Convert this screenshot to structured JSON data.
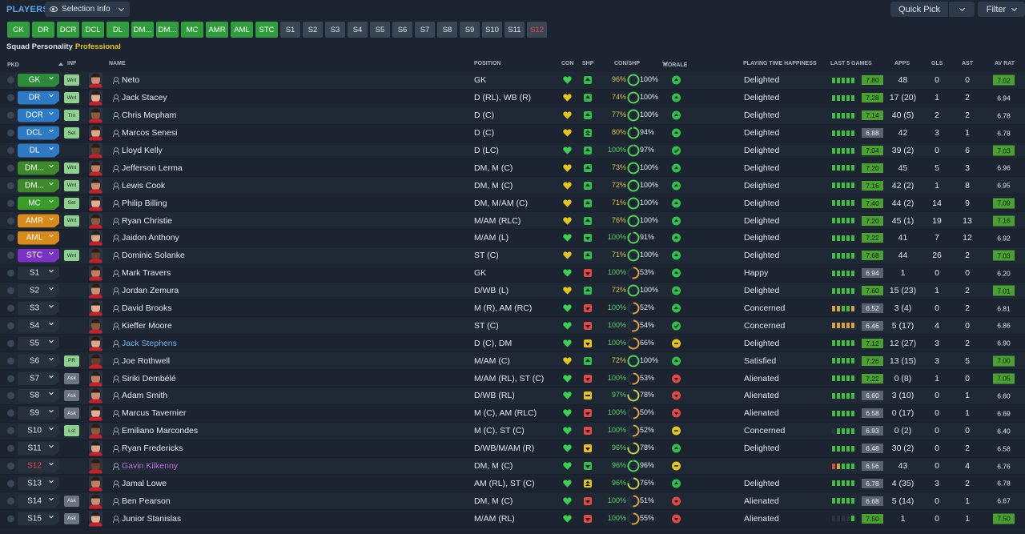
{
  "header": {
    "section_title": "PLAYERS",
    "selection_info_label": "Selection Info",
    "quick_pick_label": "Quick Pick",
    "filter_label": "Filter"
  },
  "position_buttons": {
    "main": [
      "GK",
      "DR",
      "DCR",
      "DCL",
      "DL",
      "DM...",
      "DM...",
      "MC",
      "AMR",
      "AML",
      "STC"
    ],
    "subs": [
      "S1",
      "S2",
      "S3",
      "S4",
      "S5",
      "S6",
      "S7",
      "S8",
      "S9",
      "S10",
      "S11",
      "S12"
    ]
  },
  "squad_personality": {
    "label": "Squad Personality",
    "value": "Professional"
  },
  "columns": {
    "pkd": "PKD",
    "inf": "INF",
    "name": "NAME",
    "position": "POSITION",
    "con": "CON",
    "shp": "SHP",
    "conshp": "CON/SHP",
    "morale": "MORALE",
    "pth": "PLAYING TIME HAPPINESS",
    "last5": "LAST 5 GAMES",
    "apps": "APPS",
    "gls": "GLS",
    "ast": "AST",
    "avrat": "AV RAT"
  },
  "colors": {
    "rating_hi": "#4aa030",
    "con_yellow": "#d8c24a",
    "con_green": "#57d16a",
    "personality": "#e6c419"
  },
  "players": [
    {
      "sel": "GK",
      "selc": "gk",
      "inf": "Wnt",
      "infc": "green",
      "name": "Neto",
      "pos": "GK",
      "con": "green",
      "shp": "green",
      "shp_icon": "up",
      "con_pct": "96%",
      "con_hi": false,
      "shp_pct": "100%",
      "ring": 1.0,
      "morale": "a",
      "pth": "Delighted",
      "l5": [
        "g",
        "g",
        "g",
        "g",
        "g"
      ],
      "l5r": "7.80",
      "l5c": "g",
      "apps": "48",
      "gls": "0",
      "ast": "0",
      "av": "7.02",
      "avhi": true
    },
    {
      "sel": "DR",
      "selc": "d",
      "inf": "Wnt",
      "infc": "green",
      "name": "Jack Stacey",
      "pos": "D (RL), WB (R)",
      "con": "yellow",
      "shp": "green",
      "shp_icon": "up",
      "con_pct": "74%",
      "con_hi": false,
      "shp_pct": "100%",
      "ring": 1.0,
      "morale": "a",
      "pth": "Delighted",
      "l5": [
        "g",
        "g",
        "g",
        "g",
        "g"
      ],
      "l5r": "7.28",
      "l5c": "g",
      "apps": "17 (20)",
      "gls": "1",
      "ast": "2",
      "av": "6.94",
      "avhi": false
    },
    {
      "sel": "DCR",
      "selc": "d",
      "inf": "Trn",
      "infc": "green",
      "name": "Chris Mepham",
      "pos": "D (C)",
      "con": "yellow",
      "shp": "green",
      "shp_icon": "up",
      "con_pct": "77%",
      "con_hi": false,
      "shp_pct": "100%",
      "ring": 1.0,
      "morale": "a",
      "pth": "Delighted",
      "l5": [
        "g",
        "g",
        "g",
        "g",
        "g"
      ],
      "l5r": "7.14",
      "l5c": "g",
      "apps": "40 (5)",
      "gls": "2",
      "ast": "2",
      "av": "6.78",
      "avhi": false
    },
    {
      "sel": "DCL",
      "selc": "d",
      "inf": "Set",
      "infc": "green",
      "name": "Marcos Senesi",
      "pos": "D (C)",
      "con": "yellow",
      "shp": "green",
      "shp_icon": "upup",
      "con_pct": "80%",
      "con_hi": false,
      "shp_pct": "94%",
      "ring": 0.94,
      "morale": "a",
      "pth": "Delighted",
      "l5": [
        "g",
        "g",
        "g",
        "g",
        "g"
      ],
      "l5r": "6.88",
      "l5c": "n",
      "apps": "42",
      "gls": "3",
      "ast": "1",
      "av": "6.78",
      "avhi": false
    },
    {
      "sel": "DL",
      "selc": "d",
      "inf": "",
      "infc": "",
      "name": "Lloyd Kelly",
      "pos": "D (LC)",
      "con": "green",
      "shp": "green",
      "shp_icon": "up",
      "con_pct": "100%",
      "con_hi": true,
      "shp_pct": "97%",
      "ring": 0.97,
      "morale": "b",
      "pth": "Delighted",
      "l5": [
        "g",
        "g",
        "g",
        "g",
        "g"
      ],
      "l5r": "7.04",
      "l5c": "g",
      "apps": "39 (2)",
      "gls": "0",
      "ast": "6",
      "av": "7.03",
      "avhi": true
    },
    {
      "sel": "DM...",
      "selc": "dm",
      "inf": "Wnt",
      "infc": "green",
      "name": "Jefferson Lerma",
      "pos": "DM, M (C)",
      "con": "yellow",
      "shp": "green",
      "shp_icon": "up",
      "con_pct": "73%",
      "con_hi": false,
      "shp_pct": "100%",
      "ring": 1.0,
      "morale": "a",
      "pth": "Delighted",
      "l5": [
        "g",
        "g",
        "g",
        "g",
        "g"
      ],
      "l5r": "7.20",
      "l5c": "g",
      "apps": "45",
      "gls": "5",
      "ast": "3",
      "av": "6.96",
      "avhi": false
    },
    {
      "sel": "DM...",
      "selc": "dm",
      "inf": "Wnt",
      "infc": "green",
      "name": "Lewis Cook",
      "pos": "DM, M (C)",
      "con": "yellow",
      "shp": "green",
      "shp_icon": "up",
      "con_pct": "72%",
      "con_hi": false,
      "shp_pct": "100%",
      "ring": 1.0,
      "morale": "a",
      "pth": "Delighted",
      "l5": [
        "g",
        "g",
        "g",
        "g",
        "g"
      ],
      "l5r": "7.16",
      "l5c": "g",
      "apps": "42 (2)",
      "gls": "1",
      "ast": "8",
      "av": "6.95",
      "avhi": false
    },
    {
      "sel": "MC",
      "selc": "mc",
      "inf": "Set",
      "infc": "green",
      "name": "Philip Billing",
      "pos": "DM, M/AM (C)",
      "con": "yellow",
      "shp": "green",
      "shp_icon": "up",
      "con_pct": "71%",
      "con_hi": false,
      "shp_pct": "100%",
      "ring": 1.0,
      "morale": "a",
      "pth": "Delighted",
      "l5": [
        "g",
        "g",
        "g",
        "g",
        "g"
      ],
      "l5r": "7.40",
      "l5c": "g",
      "apps": "44 (2)",
      "gls": "14",
      "ast": "9",
      "av": "7.09",
      "avhi": true
    },
    {
      "sel": "AMR",
      "selc": "am",
      "inf": "Wnt",
      "infc": "green",
      "name": "Ryan Christie",
      "pos": "M/AM (RLC)",
      "con": "yellow",
      "shp": "green",
      "shp_icon": "up",
      "con_pct": "76%",
      "con_hi": false,
      "shp_pct": "100%",
      "ring": 1.0,
      "morale": "a",
      "pth": "Delighted",
      "l5": [
        "g",
        "g",
        "g",
        "g",
        "g"
      ],
      "l5r": "7.20",
      "l5c": "g",
      "apps": "45 (1)",
      "gls": "19",
      "ast": "13",
      "av": "7.16",
      "avhi": true
    },
    {
      "sel": "AML",
      "selc": "am",
      "inf": "",
      "infc": "",
      "name": "Jaidon Anthony",
      "pos": "M/AM (L)",
      "con": "green",
      "shp": "green",
      "shp_icon": "down",
      "con_pct": "100%",
      "con_hi": true,
      "shp_pct": "91%",
      "ring": 0.91,
      "morale": "a",
      "pth": "Delighted",
      "l5": [
        "g",
        "g",
        "g",
        "g",
        "g"
      ],
      "l5r": "7.22",
      "l5c": "g",
      "apps": "41",
      "gls": "7",
      "ast": "12",
      "av": "6.92",
      "avhi": false
    },
    {
      "sel": "STC",
      "selc": "st",
      "inf": "Wnt",
      "infc": "green",
      "name": "Dominic Solanke",
      "pos": "ST (C)",
      "con": "yellow",
      "shp": "green",
      "shp_icon": "up",
      "con_pct": "71%",
      "con_hi": false,
      "shp_pct": "100%",
      "ring": 1.0,
      "morale": "a",
      "pth": "Delighted",
      "l5": [
        "g",
        "g",
        "g",
        "g",
        "g"
      ],
      "l5r": "7.68",
      "l5c": "g",
      "apps": "44",
      "gls": "26",
      "ast": "2",
      "av": "7.03",
      "avhi": true
    },
    {
      "sel": "S1",
      "selc": "sub",
      "inf": "",
      "infc": "",
      "name": "Mark Travers",
      "pos": "GK",
      "con": "green",
      "shp": "red",
      "shp_icon": "down",
      "con_pct": "100%",
      "con_hi": true,
      "shp_pct": "53%",
      "ring": 0.53,
      "morale": "a",
      "pth": "Happy",
      "l5": [
        "g",
        "g",
        "g",
        "g",
        "g"
      ],
      "l5r": "6.94",
      "l5c": "n",
      "apps": "1",
      "gls": "0",
      "ast": "0",
      "av": "6.20",
      "avhi": false
    },
    {
      "sel": "S2",
      "selc": "sub",
      "inf": "",
      "infc": "",
      "name": "Jordan Zemura",
      "pos": "D/WB (L)",
      "con": "yellow",
      "shp": "green",
      "shp_icon": "up",
      "con_pct": "72%",
      "con_hi": false,
      "shp_pct": "100%",
      "ring": 1.0,
      "morale": "a",
      "pth": "Delighted",
      "l5": [
        "g",
        "g",
        "g",
        "g",
        "g"
      ],
      "l5r": "7.60",
      "l5c": "g",
      "apps": "15 (23)",
      "gls": "1",
      "ast": "2",
      "av": "7.01",
      "avhi": true
    },
    {
      "sel": "S3",
      "selc": "sub",
      "inf": "",
      "infc": "",
      "name": "David Brooks",
      "pos": "M (R), AM (RC)",
      "con": "green",
      "shp": "red",
      "shp_icon": "down",
      "con_pct": "100%",
      "con_hi": true,
      "shp_pct": "52%",
      "ring": 0.52,
      "morale": "a",
      "pth": "Concerned",
      "l5": [
        "o",
        "o",
        "g",
        "g",
        "o"
      ],
      "l5r": "6.52",
      "l5c": "n",
      "apps": "3 (4)",
      "gls": "0",
      "ast": "2",
      "av": "6.81",
      "avhi": false
    },
    {
      "sel": "S4",
      "selc": "sub",
      "inf": "",
      "infc": "",
      "name": "Kieffer Moore",
      "pos": "ST (C)",
      "con": "green",
      "shp": "red",
      "shp_icon": "down",
      "con_pct": "100%",
      "con_hi": true,
      "shp_pct": "54%",
      "ring": 0.54,
      "morale": "b",
      "pth": "Concerned",
      "l5": [
        "o",
        "o",
        "o",
        "o",
        "o"
      ],
      "l5r": "6.46",
      "l5c": "n",
      "apps": "5 (17)",
      "gls": "4",
      "ast": "0",
      "av": "6.86",
      "avhi": false
    },
    {
      "sel": "S5",
      "selc": "sub",
      "inf": "",
      "infc": "",
      "name": "Jack Stephens",
      "pos": "D (C), DM",
      "con": "green",
      "shp": "yellow",
      "shp_icon": "down",
      "con_pct": "100%",
      "con_hi": true,
      "shp_pct": "66%",
      "ring": 0.66,
      "morale": "y",
      "pth": "Delighted",
      "l5": [
        "g",
        "g",
        "g",
        "g",
        "g"
      ],
      "l5r": "7.12",
      "l5c": "g",
      "apps": "12 (27)",
      "gls": "3",
      "ast": "2",
      "av": "6.90",
      "avhi": false,
      "namec": "blue"
    },
    {
      "sel": "S6",
      "selc": "sub",
      "inf": "PR",
      "infc": "green",
      "name": "Joe Rothwell",
      "pos": "M/AM (C)",
      "con": "yellow",
      "shp": "green",
      "shp_icon": "up",
      "con_pct": "72%",
      "con_hi": false,
      "shp_pct": "100%",
      "ring": 1.0,
      "morale": "a",
      "pth": "Satisfied",
      "l5": [
        "g",
        "g",
        "g",
        "g",
        "g"
      ],
      "l5r": "7.26",
      "l5c": "g",
      "apps": "13 (15)",
      "gls": "3",
      "ast": "5",
      "av": "7.00",
      "avhi": true
    },
    {
      "sel": "S7",
      "selc": "sub",
      "inf": "Ask",
      "infc": "gray",
      "name": "Siriki Dembélé",
      "pos": "M/AM (RL), ST (C)",
      "con": "green",
      "shp": "red",
      "shp_icon": "down",
      "con_pct": "100%",
      "con_hi": true,
      "shp_pct": "53%",
      "ring": 0.53,
      "morale": "r",
      "pth": "Alienated",
      "l5": [
        "g",
        "g",
        "g",
        "g",
        "g"
      ],
      "l5r": "7.22",
      "l5c": "g",
      "apps": "0 (8)",
      "gls": "1",
      "ast": "0",
      "av": "7.05",
      "avhi": true
    },
    {
      "sel": "S8",
      "selc": "sub",
      "inf": "Ask",
      "infc": "gray",
      "name": "Adam Smith",
      "pos": "D/WB (RL)",
      "con": "green",
      "shp": "yellow",
      "shp_icon": "eq",
      "con_pct": "97%",
      "con_hi": true,
      "shp_pct": "78%",
      "ring": 0.78,
      "morale": "r",
      "pth": "Alienated",
      "l5": [
        "g",
        "g",
        "g",
        "g",
        "g"
      ],
      "l5r": "6.60",
      "l5c": "n",
      "apps": "3 (10)",
      "gls": "0",
      "ast": "1",
      "av": "6.60",
      "avhi": false
    },
    {
      "sel": "S9",
      "selc": "sub",
      "inf": "Ask",
      "infc": "gray",
      "name": "Marcus Tavernier",
      "pos": "M (C), AM (RLC)",
      "con": "green",
      "shp": "red",
      "shp_icon": "down",
      "con_pct": "100%",
      "con_hi": true,
      "shp_pct": "50%",
      "ring": 0.5,
      "morale": "r",
      "pth": "Alienated",
      "l5": [
        "g",
        "g",
        "g",
        "g",
        "g"
      ],
      "l5r": "6.58",
      "l5c": "n",
      "apps": "0 (17)",
      "gls": "0",
      "ast": "1",
      "av": "6.69",
      "avhi": false
    },
    {
      "sel": "S10",
      "selc": "sub",
      "inf": "Lst",
      "infc": "green",
      "name": "Emiliano Marcondes",
      "pos": "M (C), ST (C)",
      "con": "green",
      "shp": "red",
      "shp_icon": "down",
      "con_pct": "100%",
      "con_hi": true,
      "shp_pct": "52%",
      "ring": 0.52,
      "morale": "y",
      "pth": "Concerned",
      "l5": [
        "e",
        "g",
        "g",
        "g",
        "g"
      ],
      "l5r": "6.93",
      "l5c": "n",
      "apps": "0 (2)",
      "gls": "0",
      "ast": "0",
      "av": "6.40",
      "avhi": false
    },
    {
      "sel": "S11",
      "selc": "sub",
      "inf": "",
      "infc": "",
      "name": "Ryan Fredericks",
      "pos": "D/WB/M/AM (R)",
      "con": "green",
      "shp": "yellow",
      "shp_icon": "down",
      "con_pct": "96%",
      "con_hi": true,
      "shp_pct": "78%",
      "ring": 0.78,
      "morale": "a",
      "pth": "Delighted",
      "l5": [
        "g",
        "g",
        "g",
        "g",
        "g"
      ],
      "l5r": "6.48",
      "l5c": "n",
      "apps": "30 (2)",
      "gls": "0",
      "ast": "2",
      "av": "6.58",
      "avhi": false
    },
    {
      "sel": "S12",
      "selc": "subred",
      "inf": "",
      "infc": "",
      "name": "Gavin Kilkenny",
      "pos": "DM, M (C)",
      "con": "green",
      "shp": "green",
      "shp_icon": "down",
      "con_pct": "96%",
      "con_hi": true,
      "shp_pct": "96%",
      "ring": 0.96,
      "morale": "y",
      "pth": "",
      "l5": [
        "r",
        "o",
        "g",
        "g",
        "g"
      ],
      "l5r": "6.56",
      "l5c": "n",
      "apps": "43",
      "gls": "0",
      "ast": "4",
      "av": "6.76",
      "avhi": false,
      "namec": "purple"
    },
    {
      "sel": "S13",
      "selc": "sub",
      "inf": "",
      "infc": "",
      "name": "Jamal Lowe",
      "pos": "AM (RL), ST (C)",
      "con": "green",
      "shp": "yellow",
      "shp_icon": "upup",
      "con_pct": "96%",
      "con_hi": true,
      "shp_pct": "76%",
      "ring": 0.76,
      "morale": "a",
      "pth": "Delighted",
      "l5": [
        "g",
        "g",
        "g",
        "g",
        "g"
      ],
      "l5r": "6.78",
      "l5c": "n",
      "apps": "4 (35)",
      "gls": "3",
      "ast": "2",
      "av": "6.78",
      "avhi": false
    },
    {
      "sel": "S14",
      "selc": "sub",
      "inf": "Ask",
      "infc": "gray",
      "name": "Ben Pearson",
      "pos": "DM, M (C)",
      "con": "green",
      "shp": "red",
      "shp_icon": "down",
      "con_pct": "100%",
      "con_hi": true,
      "shp_pct": "51%",
      "ring": 0.51,
      "morale": "r",
      "pth": "Alienated",
      "l5": [
        "g",
        "g",
        "g",
        "g",
        "g"
      ],
      "l5r": "6.68",
      "l5c": "n",
      "apps": "5 (14)",
      "gls": "0",
      "ast": "1",
      "av": "6.67",
      "avhi": false
    },
    {
      "sel": "S15",
      "selc": "sub",
      "inf": "Ask",
      "infc": "gray",
      "name": "Junior Stanislas",
      "pos": "M/AM (RL)",
      "con": "green",
      "shp": "red",
      "shp_icon": "down",
      "con_pct": "100%",
      "con_hi": true,
      "shp_pct": "55%",
      "ring": 0.55,
      "morale": "r",
      "pth": "Alienated",
      "l5": [
        "e",
        "e",
        "e",
        "e",
        "g"
      ],
      "l5r": "7.50",
      "l5c": "g",
      "apps": "1",
      "gls": "0",
      "ast": "1",
      "av": "7.50",
      "avhi": true
    }
  ]
}
